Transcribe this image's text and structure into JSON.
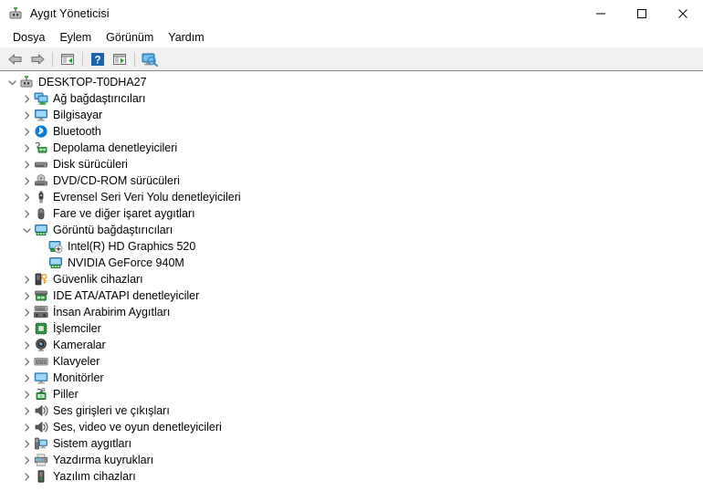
{
  "window": {
    "title": "Aygıt Yöneticisi",
    "app_icon": "device-manager-icon",
    "controls": {
      "minimize": "minimize-icon",
      "maximize": "maximize-icon",
      "close": "close-icon"
    }
  },
  "menubar": {
    "items": [
      {
        "label": "Dosya"
      },
      {
        "label": "Eylem"
      },
      {
        "label": "Görünüm"
      },
      {
        "label": "Yardım"
      }
    ]
  },
  "toolbar": {
    "buttons": [
      {
        "name": "back-button",
        "icon": "back-arrow-icon"
      },
      {
        "name": "forward-button",
        "icon": "forward-arrow-icon"
      },
      {
        "name": "separator-1",
        "icon": "separator"
      },
      {
        "name": "properties-button",
        "icon": "properties-icon"
      },
      {
        "name": "separator-2",
        "icon": "separator"
      },
      {
        "name": "help-button",
        "icon": "help-icon"
      },
      {
        "name": "update-driver-button",
        "icon": "update-driver-icon"
      },
      {
        "name": "separator-3",
        "icon": "separator"
      },
      {
        "name": "scan-hardware-button",
        "icon": "scan-hardware-icon"
      }
    ]
  },
  "tree": {
    "root": {
      "label": "DESKTOP-T0DHA27",
      "icon": "computer-root-icon",
      "expanded": true,
      "depth": 0
    },
    "nodes": [
      {
        "label": "Ağ bağdaştırıcıları",
        "icon": "network-adapter-icon",
        "expanded": false,
        "depth": 1
      },
      {
        "label": "Bilgisayar",
        "icon": "computer-icon",
        "expanded": false,
        "depth": 1
      },
      {
        "label": "Bluetooth",
        "icon": "bluetooth-icon",
        "expanded": false,
        "depth": 1
      },
      {
        "label": "Depolama denetleyicileri",
        "icon": "storage-controller-icon",
        "expanded": false,
        "depth": 1
      },
      {
        "label": "Disk sürücüleri",
        "icon": "disk-drive-icon",
        "expanded": false,
        "depth": 1
      },
      {
        "label": "DVD/CD-ROM sürücüleri",
        "icon": "dvd-drive-icon",
        "expanded": false,
        "depth": 1
      },
      {
        "label": "Evrensel Seri Veri Yolu denetleyicileri",
        "icon": "usb-controller-icon",
        "expanded": false,
        "depth": 1
      },
      {
        "label": "Fare ve diğer işaret aygıtları",
        "icon": "mouse-icon",
        "expanded": false,
        "depth": 1
      },
      {
        "label": "Görüntü bağdaştırıcıları",
        "icon": "display-adapter-icon",
        "expanded": true,
        "depth": 1
      },
      {
        "label": "Intel(R) HD Graphics 520",
        "icon": "display-device-icon",
        "expanded": null,
        "depth": 2
      },
      {
        "label": "NVIDIA GeForce 940M",
        "icon": "display-adapter-icon",
        "expanded": null,
        "depth": 2
      },
      {
        "label": "Güvenlik cihazları",
        "icon": "security-device-icon",
        "expanded": false,
        "depth": 1
      },
      {
        "label": "IDE ATA/ATAPI denetleyiciler",
        "icon": "ide-controller-icon",
        "expanded": false,
        "depth": 1
      },
      {
        "label": "İnsan Arabirim Aygıtları",
        "icon": "hid-icon",
        "expanded": false,
        "depth": 1
      },
      {
        "label": "İşlemciler",
        "icon": "processor-icon",
        "expanded": false,
        "depth": 1
      },
      {
        "label": "Kameralar",
        "icon": "camera-icon",
        "expanded": false,
        "depth": 1
      },
      {
        "label": "Klavyeler",
        "icon": "keyboard-icon",
        "expanded": false,
        "depth": 1
      },
      {
        "label": "Monitörler",
        "icon": "monitor-icon",
        "expanded": false,
        "depth": 1
      },
      {
        "label": "Piller",
        "icon": "battery-icon",
        "expanded": false,
        "depth": 1
      },
      {
        "label": "Ses girişleri ve çıkışları",
        "icon": "audio-io-icon",
        "expanded": false,
        "depth": 1
      },
      {
        "label": "Ses, video ve oyun denetleyicileri",
        "icon": "audio-io-icon",
        "expanded": false,
        "depth": 1
      },
      {
        "label": "Sistem aygıtları",
        "icon": "system-device-icon",
        "expanded": false,
        "depth": 1
      },
      {
        "label": "Yazdırma kuyrukları",
        "icon": "printer-icon",
        "expanded": false,
        "depth": 1
      },
      {
        "label": "Yazılım cihazları",
        "icon": "software-device-icon",
        "expanded": false,
        "depth": 1
      }
    ]
  },
  "colors": {
    "toolbar_bg": "#f0f0f0",
    "toolbar_border": "#8a8a8a",
    "text": "#000000",
    "twisty": "#767676",
    "bluetooth_blue": "#0a7ad8",
    "icon_green": "#2d8a3e",
    "icon_screen_blue": "#4aa3e0"
  }
}
